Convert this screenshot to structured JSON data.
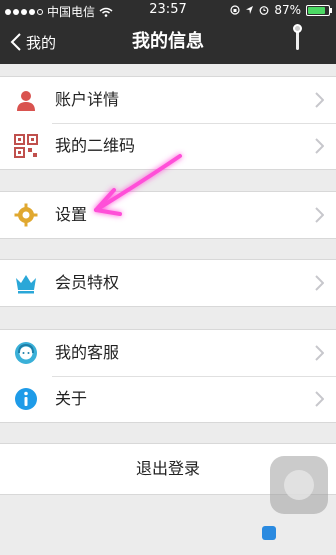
{
  "status_bar": {
    "carrier": "中国电信",
    "time": "23:57",
    "battery_pct": "87%",
    "battery_level": 0.87,
    "signal_bars_filled": 4,
    "signal_bars_total": 5
  },
  "navbar": {
    "back_label": "我的",
    "title": "我的信息"
  },
  "groups": [
    {
      "rows": [
        {
          "label": "账户详情",
          "icon": "person-icon"
        },
        {
          "label": "我的二维码",
          "icon": "qr-code-icon"
        }
      ]
    },
    {
      "rows": [
        {
          "label": "设置",
          "icon": "gear-icon"
        }
      ]
    },
    {
      "rows": [
        {
          "label": "会员特权",
          "icon": "crown-icon"
        }
      ]
    },
    {
      "rows": [
        {
          "label": "我的客服",
          "icon": "customer-service-icon"
        },
        {
          "label": "关于",
          "icon": "info-icon"
        }
      ]
    }
  ],
  "logout_label": "退出登录",
  "colors": {
    "bar_bg": "#2e2e2e",
    "page_bg": "#ececec",
    "arrow": "#ff4fd8",
    "person": "#d9534f",
    "gear": "#e0a830",
    "crown": "#2aa7d8",
    "info": "#1e9be8"
  }
}
